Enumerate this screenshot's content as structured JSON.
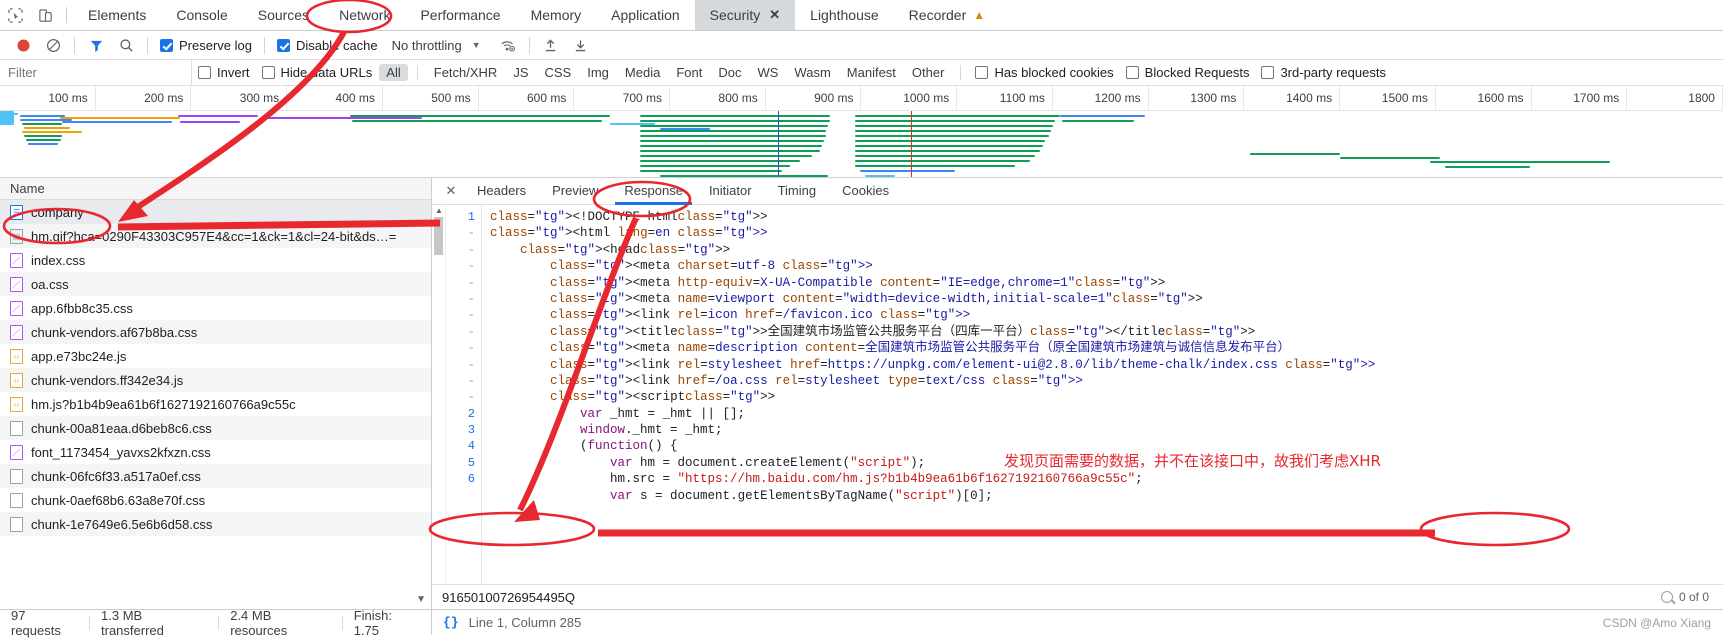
{
  "tabbar": {
    "icons": [
      "inspect-icon",
      "device-toggle-icon"
    ],
    "tabs": [
      {
        "label": "Elements",
        "selected": false,
        "closable": false,
        "warning": false
      },
      {
        "label": "Console",
        "selected": false,
        "closable": false,
        "warning": false
      },
      {
        "label": "Sources",
        "selected": false,
        "closable": false,
        "warning": false
      },
      {
        "label": "Network",
        "selected": false,
        "closable": false,
        "warning": false
      },
      {
        "label": "Performance",
        "selected": false,
        "closable": false,
        "warning": false
      },
      {
        "label": "Memory",
        "selected": false,
        "closable": false,
        "warning": false
      },
      {
        "label": "Application",
        "selected": false,
        "closable": false,
        "warning": false
      },
      {
        "label": "Security",
        "selected": true,
        "closable": true,
        "warning": false
      },
      {
        "label": "Lighthouse",
        "selected": false,
        "closable": false,
        "warning": false
      },
      {
        "label": "Recorder",
        "selected": false,
        "closable": false,
        "warning": true
      }
    ],
    "close_glyph": "✕",
    "warning_glyph": "▲"
  },
  "toolbar": {
    "record_title": "record-button",
    "clear_title": "clear-button",
    "filter_title": "filter-button",
    "search_title": "search-button",
    "preserve_log": {
      "label": "Preserve log",
      "checked": true
    },
    "disable_cache": {
      "label": "Disable cache",
      "checked": true
    },
    "throttling": {
      "value": "No throttling",
      "caret": "▼"
    },
    "wifi_title": "network-conditions-icon",
    "import_title": "import-har-icon",
    "export_title": "export-har-icon"
  },
  "filterbar": {
    "placeholder": "Filter",
    "value": "",
    "invert": {
      "label": "Invert",
      "checked": false
    },
    "hide_data_urls": {
      "label": "Hide data URLs",
      "checked": false
    },
    "types": [
      {
        "label": "All",
        "selected": true
      },
      {
        "label": "Fetch/XHR",
        "selected": false
      },
      {
        "label": "JS",
        "selected": false
      },
      {
        "label": "CSS",
        "selected": false
      },
      {
        "label": "Img",
        "selected": false
      },
      {
        "label": "Media",
        "selected": false
      },
      {
        "label": "Font",
        "selected": false
      },
      {
        "label": "Doc",
        "selected": false
      },
      {
        "label": "WS",
        "selected": false
      },
      {
        "label": "Wasm",
        "selected": false
      },
      {
        "label": "Manifest",
        "selected": false
      },
      {
        "label": "Other",
        "selected": false
      }
    ],
    "has_blocked_cookies": {
      "label": "Has blocked cookies",
      "checked": false
    },
    "blocked_requests": {
      "label": "Blocked Requests",
      "checked": false
    },
    "third_party": {
      "label": "3rd-party requests",
      "checked": false
    }
  },
  "overview": {
    "ticks": [
      "100 ms",
      "200 ms",
      "300 ms",
      "400 ms",
      "500 ms",
      "600 ms",
      "700 ms",
      "800 ms",
      "900 ms",
      "1000 ms",
      "1100 ms",
      "1200 ms",
      "1300 ms",
      "1400 ms",
      "1500 ms",
      "1600 ms",
      "1700 ms",
      "1800"
    ],
    "colors": {
      "blue": "#4285f4",
      "green": "#0f9d58",
      "orange": "#f4a000",
      "purple": "#a142f4",
      "red": "#db4437",
      "cyan": "#4fc3f7"
    }
  },
  "requests": {
    "column_header": "Name",
    "rows": [
      {
        "name": "company",
        "kind": "doc",
        "selected": true
      },
      {
        "name": "hm.gif?hca=0290F43303C957E4&cc=1&ck=1&cl=24-bit&ds…=",
        "kind": "img",
        "selected": false
      },
      {
        "name": "index.css",
        "kind": "css",
        "selected": false
      },
      {
        "name": "oa.css",
        "kind": "css",
        "selected": false
      },
      {
        "name": "app.6fbb8c35.css",
        "kind": "css",
        "selected": false
      },
      {
        "name": "chunk-vendors.af67b8ba.css",
        "kind": "css",
        "selected": false
      },
      {
        "name": "app.e73bc24e.js",
        "kind": "js",
        "selected": false
      },
      {
        "name": "chunk-vendors.ff342e34.js",
        "kind": "js",
        "selected": false
      },
      {
        "name": "hm.js?b1b4b9ea61b6f1627192160766a9c55c",
        "kind": "js",
        "selected": false
      },
      {
        "name": "chunk-00a81eaa.d6beb8c6.css",
        "kind": "blank",
        "selected": false
      },
      {
        "name": "font_1173454_yavxs2kfxzn.css",
        "kind": "css",
        "selected": false
      },
      {
        "name": "chunk-06fc6f33.a517a0ef.css",
        "kind": "blank",
        "selected": false
      },
      {
        "name": "chunk-0aef68b6.63a8e70f.css",
        "kind": "blank",
        "selected": false
      },
      {
        "name": "chunk-1e7649e6.5e6b6d58.css",
        "kind": "blank",
        "selected": false
      }
    ],
    "scroll_caret": "▼"
  },
  "detail": {
    "close_glyph": "✕",
    "tabs": [
      {
        "label": "Headers",
        "selected": false
      },
      {
        "label": "Preview",
        "selected": false
      },
      {
        "label": "Response",
        "selected": true
      },
      {
        "label": "Initiator",
        "selected": false
      },
      {
        "label": "Timing",
        "selected": false
      },
      {
        "label": "Cookies",
        "selected": false
      }
    ],
    "line_numbers": [
      "1",
      "-",
      "-",
      "-",
      "-",
      "-",
      "-",
      "-",
      "-",
      "-",
      "-",
      "-",
      "2",
      "3",
      "4",
      "5",
      "6"
    ],
    "code_lines": [
      "<!DOCTYPE html>",
      "<html lang=en>",
      "    <head>",
      "        <meta charset=utf-8>",
      "        <meta http-equiv=X-UA-Compatible content=\"IE=edge,chrome=1\">",
      "        <meta name=viewport content=\"width=device-width,initial-scale=1\">",
      "        <link rel=icon href=/favicon.ico>",
      "        <title>全国建筑市场监管公共服务平台（四库一平台）</title>",
      "        <meta name=description content=全国建筑市场监管公共服务平台（原全国建筑市场建筑与诚信信息发布平台）",
      "        <link rel=stylesheet href=https://unpkg.com/element-ui@2.8.0/lib/theme-chalk/index.css>",
      "        <link href=/oa.css rel=stylesheet type=text/css>",
      "        <script>",
      "            var _hmt = _hmt || [];",
      "            window._hmt = _hmt;",
      "            (function() {",
      "                var hm = document.createElement(\"script\");",
      "                hm.src = \"https://hm.baidu.com/hm.js?b1b4b9ea61b6f1627192160766a9c55c\";",
      "                var s = document.getElementsByTagName(\"script\")[0];"
    ],
    "search_value": "91650100726954495Q",
    "match_count": "0 of 0",
    "match_icon": "search-icon"
  },
  "statusbar": {
    "requests": "97 requests",
    "transferred": "1.3 MB transferred",
    "resources": "2.4 MB resources",
    "finish": "Finish: 1.75",
    "format_icon": "{}",
    "cursor": "Line 1, Column 285",
    "watermark": "CSDN @Amo Xiang"
  },
  "annotations": {
    "color": "#e8282f",
    "note": "发现页面需要的数据，并不在该接口中，故我们考虑XHR",
    "circles": [
      "network-tab",
      "company-row",
      "response-tab",
      "search-value",
      "match-count"
    ],
    "arrows": [
      "network-to-company",
      "response-to-search",
      "company-to-right",
      "search-to-right"
    ]
  }
}
